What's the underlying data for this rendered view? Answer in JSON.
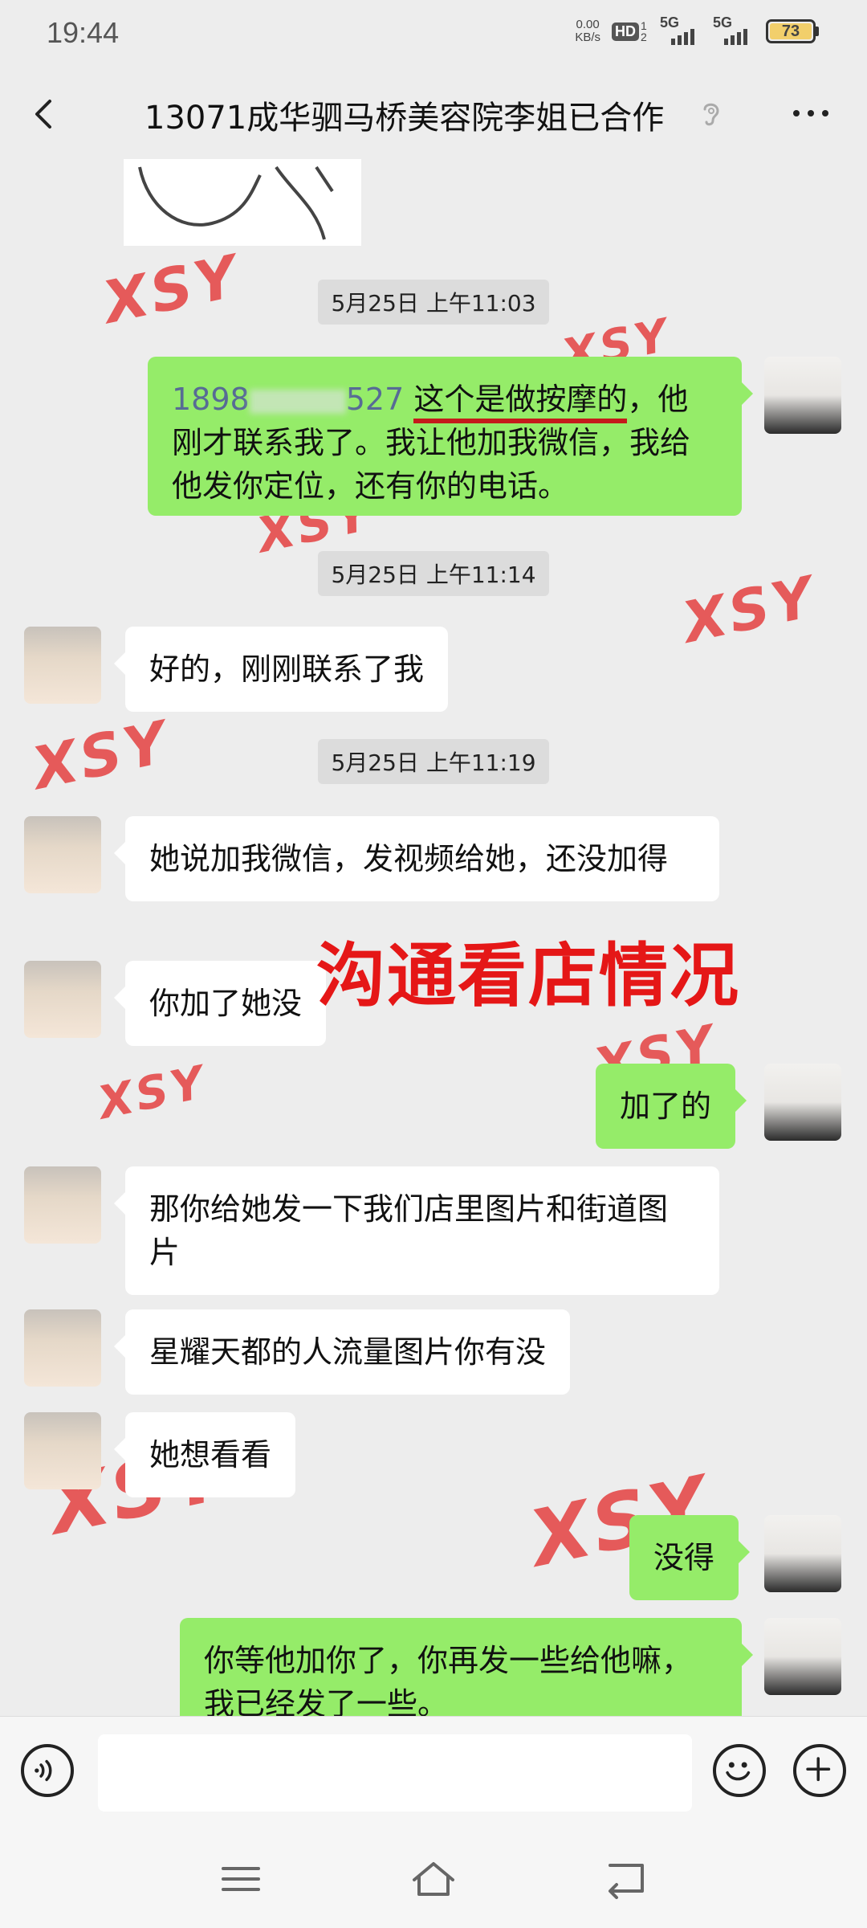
{
  "status_bar": {
    "time": "19:44",
    "net_speed_value": "0.00",
    "net_speed_unit": "KB/s",
    "hd_label": "HD",
    "hd_sub": "1 2",
    "signal1_label": "5G",
    "signal2_label": "5G",
    "battery": "73"
  },
  "nav": {
    "title": "13071成华驷马桥美容院李姐已合作",
    "back_icon": "back-chevron-icon",
    "ear_icon": "ear-icon",
    "more_icon": "more-icon"
  },
  "watermark_text": "XSY",
  "overlay_text": "沟通看店情况",
  "timestamps": [
    "5月25日 上午11:03",
    "5月25日 上午11:14",
    "5月25日 上午11:19"
  ],
  "messages": [
    {
      "side": "right",
      "phone_start": "1898",
      "phone_end": "527",
      "highlight": "这个是做按摩的",
      "rest": "，他刚才联系我了。我让他加我微信，我给他发你定位，还有你的电话。"
    },
    {
      "side": "left",
      "text": "好的，刚刚联系了我"
    },
    {
      "side": "left",
      "text": "她说加我微信，发视频给她，还没加得"
    },
    {
      "side": "left",
      "text": "你加了她没"
    },
    {
      "side": "right",
      "text": "加了的"
    },
    {
      "side": "left",
      "text": "那你给她发一下我们店里图片和街道图片"
    },
    {
      "side": "left",
      "text": "星耀天都的人流量图片你有没"
    },
    {
      "side": "left",
      "text": "她想看看"
    },
    {
      "side": "right",
      "text": "没得"
    },
    {
      "side": "right",
      "text": "你等他加你了，你再发一些给他嘛，我已经发了一些。"
    }
  ],
  "input_bar": {
    "voice_icon": "voice-icon",
    "emoji_icon": "emoji-icon",
    "plus_icon": "plus-icon",
    "input_value": ""
  },
  "colors": {
    "background": "#ededed",
    "bubble_self": "#95ec69",
    "bubble_other": "#ffffff",
    "overlay_red": "#e51717",
    "watermark_red": "#e54b4b",
    "underline_red": "#c41b1b"
  }
}
